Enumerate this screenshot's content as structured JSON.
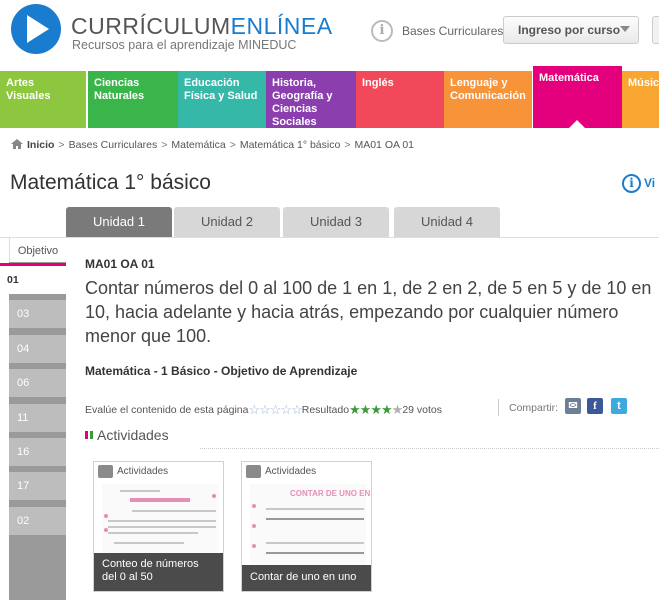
{
  "header": {
    "logo_title_a": "CURRÍCULUM",
    "logo_title_b": "ENLÍNEA",
    "logo_subtitle": "Recursos para el aprendizaje MINEDUC",
    "bases_link": "Bases Curriculares",
    "ingreso_button": "Ingreso por curso"
  },
  "subjects": [
    {
      "label": "Artes Visuales",
      "color": "#8dc63f"
    },
    {
      "label": "Ciencias Naturales",
      "color": "#3ab54a"
    },
    {
      "label": "Educación Física y Salud",
      "color": "#36b8a9"
    },
    {
      "label": "Historia, Geografía y Ciencias Sociales",
      "color": "#8b3fae"
    },
    {
      "label": "Inglés",
      "color": "#f2495a"
    },
    {
      "label": "Lenguaje y Comunicación",
      "color": "#f7943a"
    },
    {
      "label": "Matemática",
      "color": "#e4007c"
    },
    {
      "label": "Música",
      "color": "#f9a532"
    }
  ],
  "breadcrumb": {
    "home": "Inicio",
    "items": [
      "Bases Curriculares",
      "Matemática",
      "Matemática 1° básico",
      "MA01 OA 01"
    ]
  },
  "page_title": "Matemática 1° básico",
  "ver_label": "Vi",
  "unit_tabs": [
    "Unidad 1",
    "Unidad 2",
    "Unidad 3",
    "Unidad 4"
  ],
  "sidebar": {
    "objetivo_label": "Objetivo",
    "active_item": "01",
    "items": [
      "03",
      "04",
      "06",
      "11",
      "16",
      "17",
      "02"
    ]
  },
  "objective": {
    "code": "MA01 OA 01",
    "text": "Contar números del 0 al 100 de 1 en 1, de 2 en 2, de 5 en 5 y de 10 en 10, hacia adelante y hacia atrás, empezando por cualquier número menor que 100.",
    "meta": "Matemática - 1 Básico - Objetivo de Aprendizaje"
  },
  "rating": {
    "evaluate_label": "Evalúe el contenido de esta página",
    "result_label": "Resultado",
    "result_stars": 3.5,
    "votes": "29 votos"
  },
  "share": {
    "label": "Compartir:"
  },
  "actividades": {
    "header": "Actividades",
    "cards": [
      {
        "tag": "Actividades",
        "caption": "Conteo de números del 0 al 50",
        "doc_title": ""
      },
      {
        "tag": "Actividades",
        "caption": "Contar de uno en uno",
        "doc_title": "CONTAR DE UNO EN U"
      }
    ]
  },
  "colors": {
    "brand_blue": "#1a7ccf",
    "active_magenta": "#e4007c",
    "rating_green": "#3a9b3a"
  }
}
